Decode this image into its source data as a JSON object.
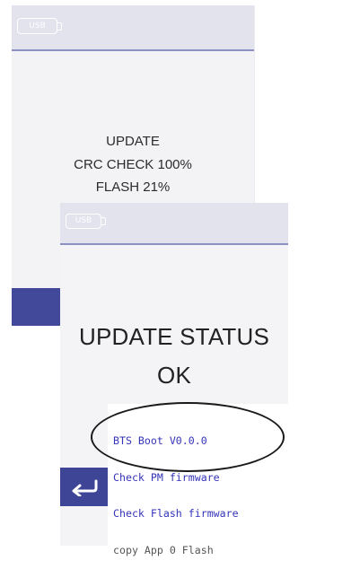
{
  "back_screen": {
    "usb_label": "USB",
    "status_lines": [
      "UPDATE",
      "CRC CHECK 100%",
      "FLASH 21%"
    ]
  },
  "front_screen": {
    "usb_label": "USB",
    "status_title": "UPDATE STATUS",
    "status_result": "OK",
    "return_button_icon": "return-arrow-icon"
  },
  "boot_log": {
    "lines": [
      "BTS Boot V0.0.0",
      "Check PM firmware",
      "Check Flash firmware",
      "copy App 0 Flash"
    ]
  },
  "colors": {
    "topbar": "#e2e3ec",
    "accent_blue": "#43499a",
    "log_text": "#3434b8"
  }
}
